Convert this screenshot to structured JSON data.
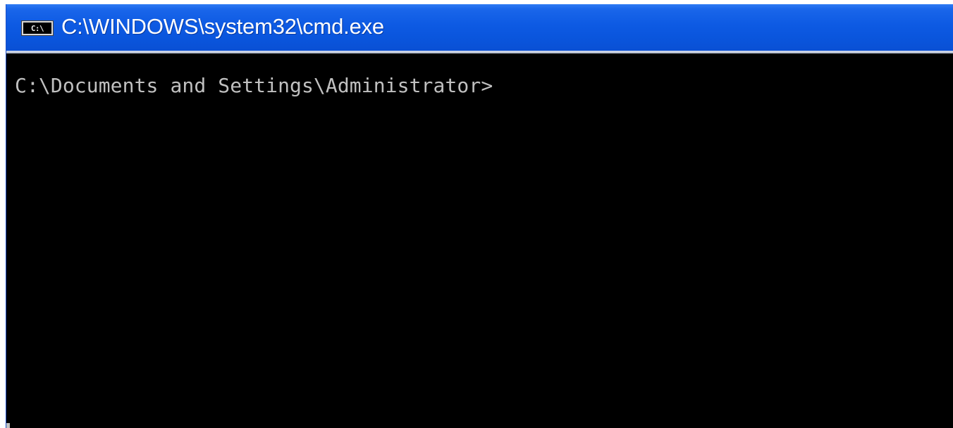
{
  "window": {
    "title": "C:\\WINDOWS\\system32\\cmd.exe",
    "icon": {
      "name": "cmd-console-icon",
      "label": "C:\\"
    }
  },
  "console": {
    "prompt": "C:\\Documents and Settings\\Administrator>",
    "background_color": "#000000",
    "text_color": "#c0c0c0"
  },
  "theme": {
    "titlebar_color": "#0a55dc",
    "title_text_color": "#ffffff"
  }
}
